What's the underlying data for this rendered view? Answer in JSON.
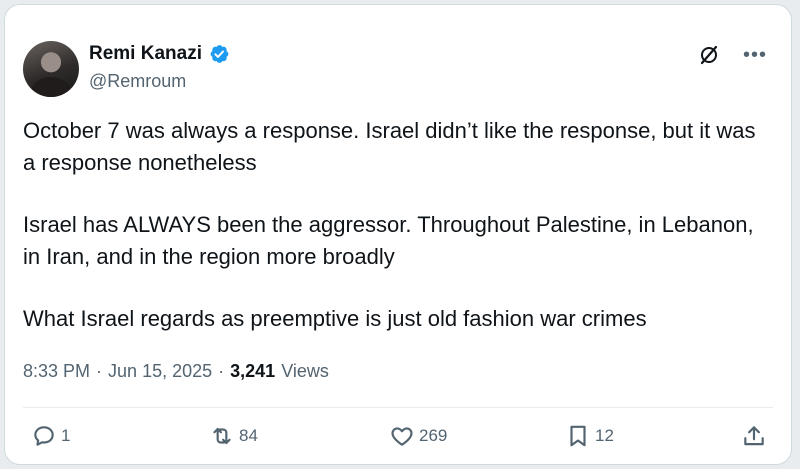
{
  "author": {
    "name": "Remi Kanazi",
    "handle": "@Remroum"
  },
  "tweet": {
    "paragraphs": [
      "October 7 was always a response. Israel didn’t like the response, but it was a response nonetheless",
      "Israel has ALWAYS been the aggressor. Throughout Palestine, in Lebanon, in Iran, and in the region more broadly",
      "What Israel regards as preemptive is just old fashion war crimes"
    ],
    "time": "8:33 PM",
    "separator": "·",
    "date": "Jun 15, 2025",
    "views_count": "3,241",
    "views_label": "Views"
  },
  "actions": {
    "reply_count": "1",
    "retweet_count": "84",
    "like_count": "269",
    "bookmark_count": "12"
  },
  "colors": {
    "verified": "#1d9bf0",
    "secondary_text": "#536471",
    "primary_text": "#0f1419"
  },
  "icons": [
    "verified-badge-icon",
    "grok-icon",
    "more-icon",
    "reply-icon",
    "retweet-icon",
    "like-icon",
    "bookmark-icon",
    "share-icon"
  ]
}
